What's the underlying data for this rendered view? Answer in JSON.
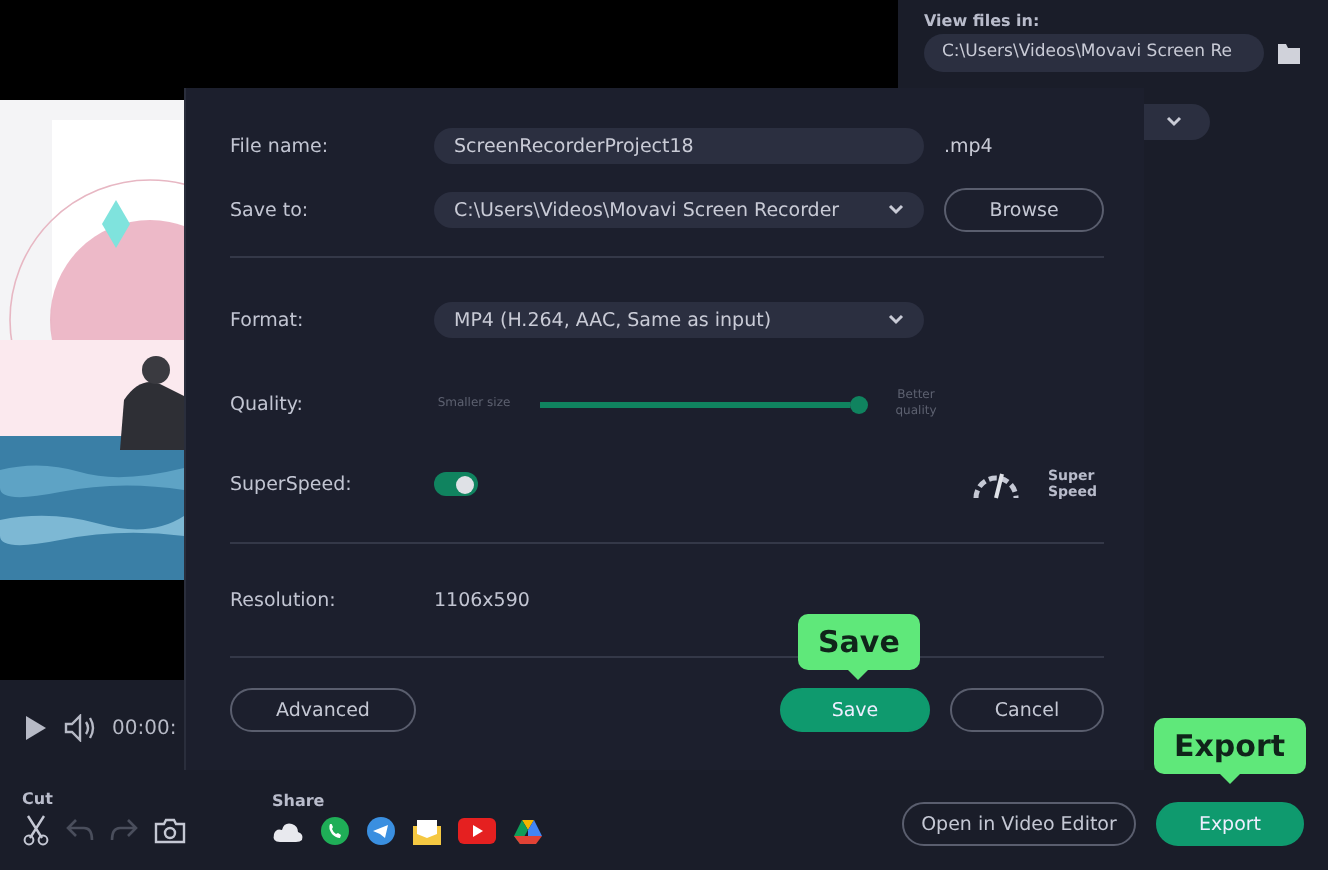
{
  "player": {
    "time": "00:00:"
  },
  "toolbar": {
    "cut_label": "Cut",
    "share_label": "Share"
  },
  "view_files": {
    "label": "View files in:",
    "path": "C:\\Users\\Videos\\Movavi Screen Re"
  },
  "bottom_buttons": [
    {
      "label": "Open in Video Editor",
      "primary": false
    },
    {
      "label": "Export",
      "primary": true
    }
  ],
  "dialog": {
    "file_name": {
      "label": "File name:",
      "value": "ScreenRecorderProject18",
      "extension": ".mp4"
    },
    "save_to": {
      "label": "Save to:",
      "value": "C:\\Users\\Videos\\Movavi Screen Recorder",
      "browse": "Browse"
    },
    "format": {
      "label": "Format:",
      "value": "MP4 (H.264, AAC, Same as input)"
    },
    "quality": {
      "label": "Quality:",
      "min_label": "Smaller size",
      "max_label": "Better quality",
      "level": 1.0
    },
    "superspeed": {
      "label": "SuperSpeed:",
      "on": true,
      "badge": "Super Speed"
    },
    "resolution": {
      "label": "Resolution:",
      "value": "1106x590"
    },
    "advanced": "Advanced",
    "buttons": [
      {
        "label": "Save",
        "primary": true
      },
      {
        "label": "Cancel",
        "primary": false
      }
    ]
  },
  "tooltips": [
    {
      "text": "Save"
    },
    {
      "text": "Export"
    }
  ]
}
